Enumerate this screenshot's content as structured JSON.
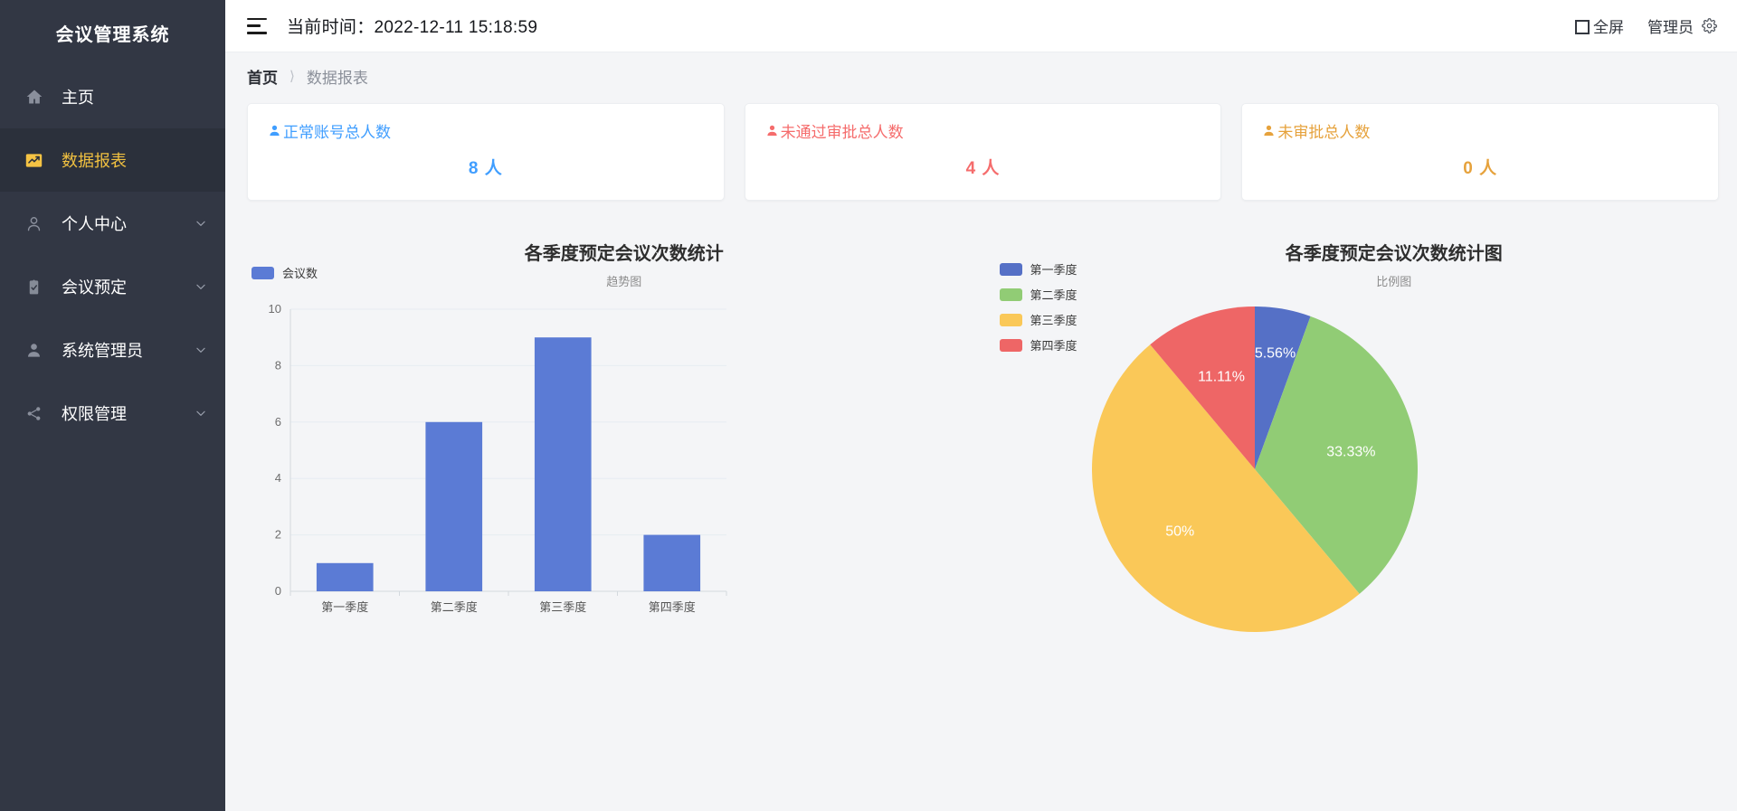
{
  "sidebar": {
    "brand": "会议管理系统",
    "items": [
      {
        "label": "主页",
        "icon": "home-icon",
        "active": false,
        "caret": false
      },
      {
        "label": "数据报表",
        "icon": "chart-icon",
        "active": true,
        "caret": false
      },
      {
        "label": "个人中心",
        "icon": "user-outline-icon",
        "active": false,
        "caret": true
      },
      {
        "label": "会议预定",
        "icon": "clipboard-check-icon",
        "active": false,
        "caret": true
      },
      {
        "label": "系统管理员",
        "icon": "user-solid-icon",
        "active": false,
        "caret": true
      },
      {
        "label": "权限管理",
        "icon": "share-nodes-icon",
        "active": false,
        "caret": true
      }
    ]
  },
  "topbar": {
    "menu_icon": "hamburger-icon",
    "time_label": "当前时间：",
    "time_value": "2022-12-11 15:18:59",
    "fullscreen_label": "全屏",
    "fullscreen_icon": "fullscreen-icon",
    "admin_label": "管理员",
    "settings_icon": "gear-icon"
  },
  "breadcrumb": {
    "home": "首页",
    "separator": "〉",
    "current": "数据报表"
  },
  "stat_cards": [
    {
      "title": "正常账号总人数",
      "value": "8 人",
      "color": "#409eff",
      "icon": "user-solid-icon"
    },
    {
      "title": "未通过审批总人数",
      "value": "4 人",
      "color": "#f56c6c",
      "icon": "user-solid-icon"
    },
    {
      "title": "未审批总人数",
      "value": "0 人",
      "color": "#e6a23c",
      "icon": "user-solid-icon"
    }
  ],
  "chart_data": [
    {
      "type": "bar",
      "title": "各季度预定会议次数统计",
      "subtitle": "趋势图",
      "categories": [
        "第一季度",
        "第二季度",
        "第三季度",
        "第四季度"
      ],
      "values": [
        1,
        6,
        9,
        2
      ],
      "series": [
        {
          "name": "会议数",
          "values": [
            1,
            6,
            9,
            2
          ]
        }
      ],
      "legend": [
        "会议数"
      ],
      "legend_position": "top-left",
      "legend_colors": [
        "#5b7bd5"
      ],
      "bar_color": "#5b7bd5",
      "xlabel": "",
      "ylabel": "",
      "ylim": [
        0,
        10
      ],
      "yticks": [
        0,
        2,
        4,
        6,
        8,
        10
      ],
      "grid": true
    },
    {
      "type": "pie",
      "title": "各季度预定会议次数统计图",
      "subtitle": "比例图",
      "labels": [
        "第一季度",
        "第二季度",
        "第三季度",
        "第四季度"
      ],
      "values": [
        1,
        6,
        9,
        2
      ],
      "percent_labels": [
        "5.56%",
        "33.33%",
        "50%",
        "11.11%"
      ],
      "colors": [
        "#5570c6",
        "#91cc75",
        "#fac858",
        "#ee6666"
      ],
      "legend": [
        "第一季度",
        "第二季度",
        "第三季度",
        "第四季度"
      ],
      "legend_position": "left",
      "grid": false
    }
  ]
}
